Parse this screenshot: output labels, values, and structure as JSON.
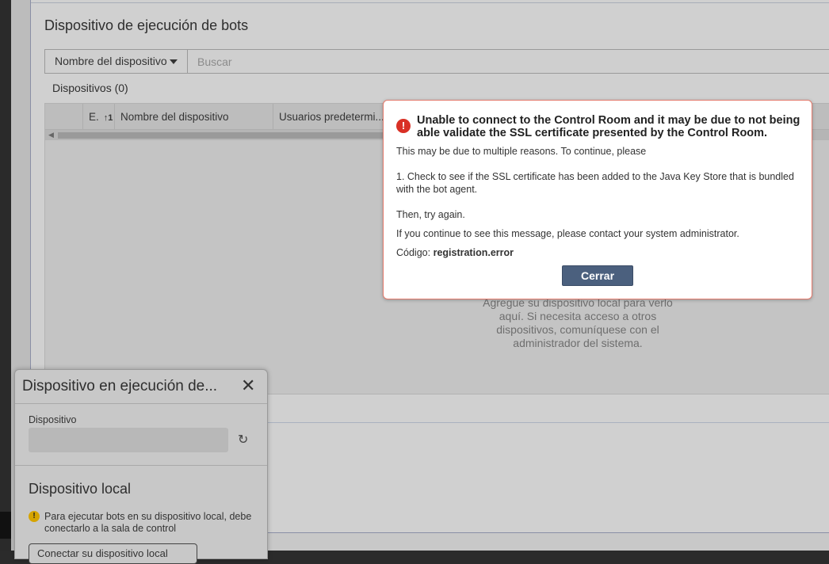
{
  "page": {
    "title": "Dispositivo de ejecución de bots",
    "filter_select": "Nombre del dispositivo",
    "search_placeholder": "Buscar",
    "devices_label": "Dispositivos",
    "devices_count": "(0)",
    "columns": [
      "E.",
      "Nombre del dispositivo",
      "Usuarios predetermi..."
    ],
    "empty_message": "Agregue su dispositivo local para verlo aquí. Si necesita acceso a otros dispositivos, comuníquese con el administrador del sistema."
  },
  "modal": {
    "title": "Unable to connect to the Control Room and it may be due to not being able validate the SSL certificate presented by the Control Room.",
    "line1": "This may be due to multiple reasons. To continue, please",
    "line2": "1. Check to see if the SSL certificate has been added to the Java Key Store that is bundled with the bot agent.",
    "line3": "Then, try again.",
    "line4": "If you continue to see this message, please contact your system administrator.",
    "code_label": "Código:",
    "code_value": "registration.error",
    "close_label": "Cerrar",
    "accent": "#4b607e",
    "error_color": "#d93025"
  },
  "side_panel": {
    "title": "Dispositivo en ejecución de...",
    "device_label": "Dispositivo",
    "local_title": "Dispositivo local",
    "warning": "Para ejecutar bots en su dispositivo local, debe conectarlo a la sala de control",
    "connect_button": "Conectar su dispositivo local"
  }
}
